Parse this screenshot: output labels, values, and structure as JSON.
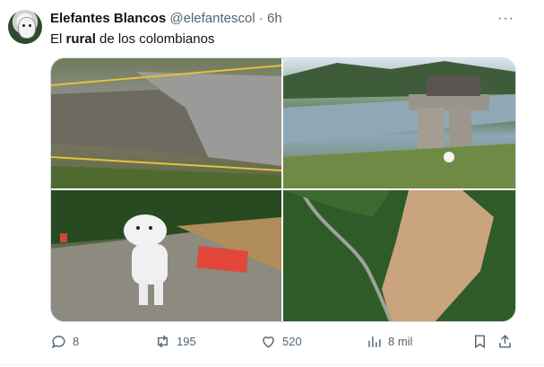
{
  "author": {
    "name": "Elefantes Blancos",
    "handle": "@elefantescol",
    "separator": "·",
    "time": "6h"
  },
  "tweet": {
    "text_before": "El ",
    "text_bold": "rural",
    "text_after": " de los colombianos"
  },
  "media": {
    "images": [
      {
        "icon": "collapsed-road-photo"
      },
      {
        "icon": "abandoned-bridge-photo"
      },
      {
        "icon": "elephant-costume-photo"
      },
      {
        "icon": "landslide-aerial-photo"
      }
    ]
  },
  "actions": {
    "replies": "8",
    "retweets": "195",
    "likes": "520",
    "views": "8 mil"
  },
  "more_label": "···"
}
